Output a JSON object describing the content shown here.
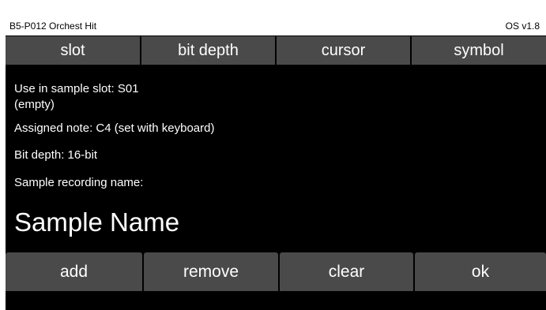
{
  "status": {
    "title": "B5-P012 Orchest Hit",
    "os_version": "OS v1.8"
  },
  "tabs": [
    {
      "label": "slot"
    },
    {
      "label": "bit depth"
    },
    {
      "label": "cursor"
    },
    {
      "label": "symbol"
    }
  ],
  "info": {
    "slot_line": "Use in sample slot: S01",
    "slot_state": "(empty)",
    "note_line": "Assigned note: C4  (set with keyboard)",
    "bitdepth_line": "Bit depth: 16-bit",
    "recording_label": "Sample recording name:",
    "sample_name": "Sample Name"
  },
  "buttons": [
    {
      "label": "add"
    },
    {
      "label": "remove"
    },
    {
      "label": "clear"
    },
    {
      "label": "ok"
    }
  ],
  "colors": {
    "screen_bg": "#000000",
    "button_bg": "#4a4a4a",
    "text": "#ffffff",
    "status_bg": "#ffffff"
  }
}
